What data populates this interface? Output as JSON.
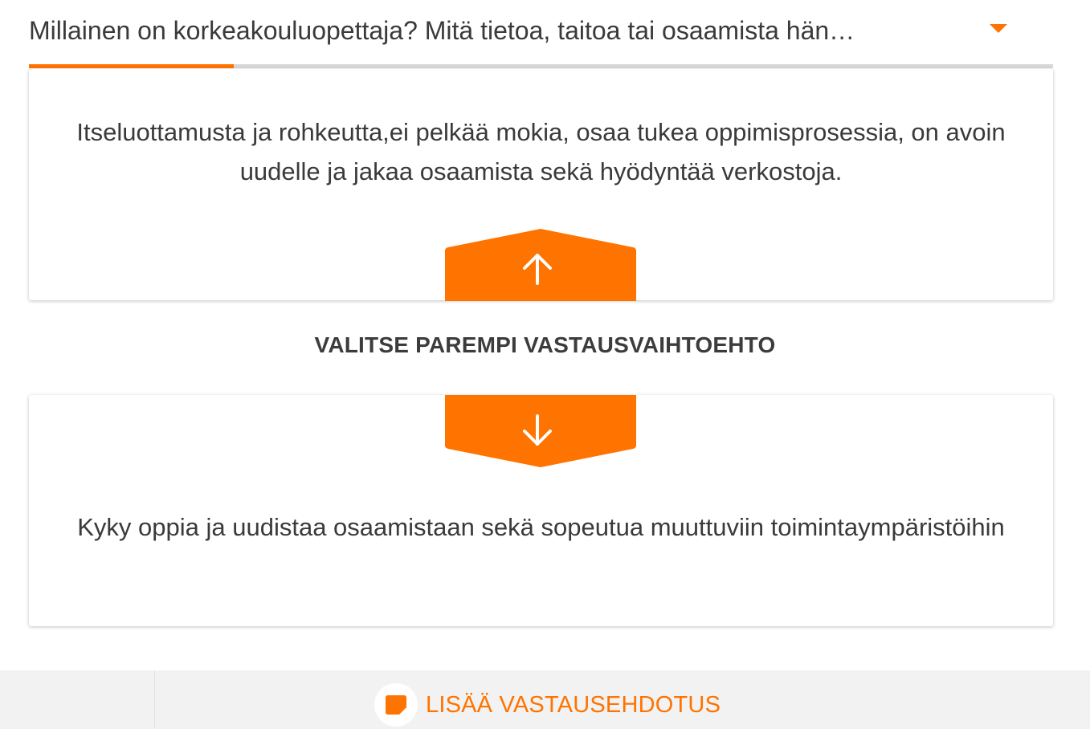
{
  "question": {
    "text": "Millainen on korkeakouluopettaja? Mitä tietoa, taitoa tai osaamista hän…",
    "progress_fraction": 0.2
  },
  "answers": {
    "top": {
      "text": "Itseluottamusta ja rohkeutta,ei pelkää mokia, osaa tukea oppimisprosessia, on avoin uudelle ja jakaa osaamista sekä hyödyntää verkostoja.",
      "vote_icon": "arrow-up-icon"
    },
    "bottom": {
      "text": "Kyky oppia ja uudistaa osaamistaan sekä sopeutua muuttuviin toimintaympäristöihin",
      "vote_icon": "arrow-down-icon"
    }
  },
  "prompt": {
    "label": "VALITSE PAREMPI VASTAUSVAIHTOEHTO"
  },
  "footer": {
    "add_label": "LISÄÄ VASTAUSEHDOTUS",
    "add_icon": "note-icon"
  },
  "colors": {
    "accent": "#ff7300",
    "text": "#3a3a3a",
    "track": "#d7d7d7",
    "footer_bg": "#f2f2f2"
  }
}
